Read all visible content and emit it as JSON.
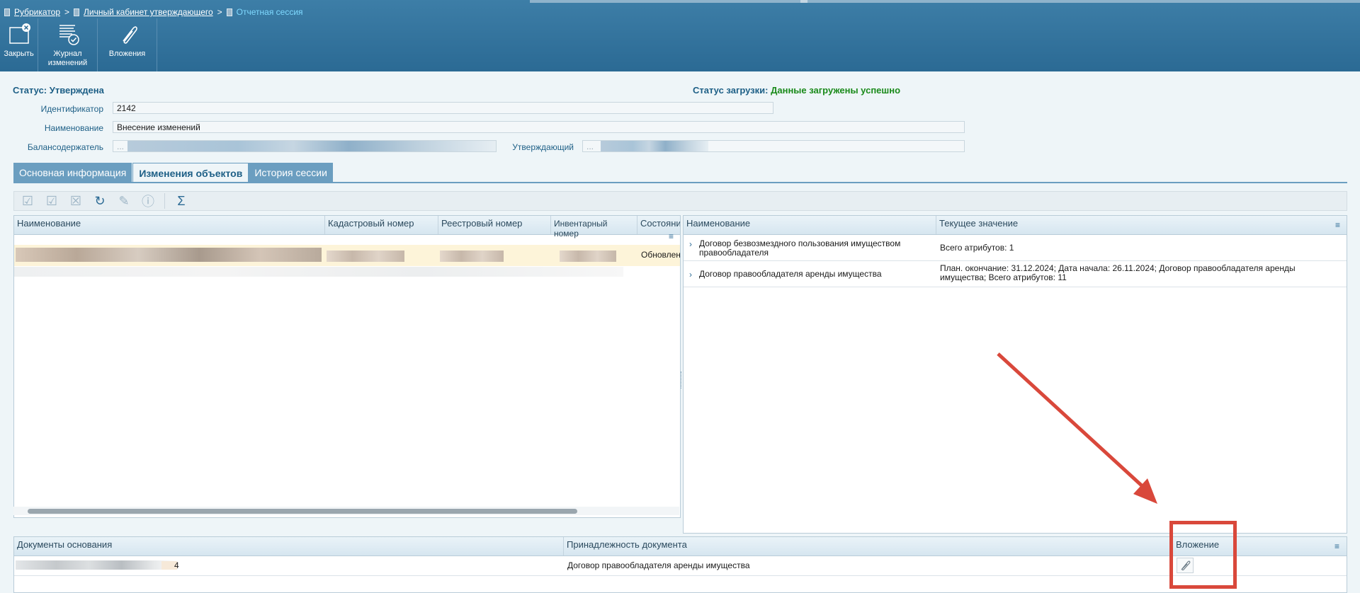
{
  "breadcrumb": {
    "items": [
      "Рубрикатор",
      "Личный кабинет утверждающего"
    ],
    "current": "Отчетная сессия",
    "separator": ">"
  },
  "toolbar": {
    "close_label": "Закрыть",
    "journal_label_1": "Журнал",
    "journal_label_2": "изменений",
    "attachments_label": "Вложения"
  },
  "status": {
    "status_text": "Статус: Утверждена",
    "upload_label": "Статус загрузки:",
    "upload_value": "Данные загружены успешно"
  },
  "fields": {
    "id_label": "Идентификатор",
    "id_value": "2142",
    "name_label": "Наименование",
    "name_value": "Внесение изменений",
    "holder_label": "Балансодержатель",
    "holder_prefix": "...",
    "approver_label": "Утверждающий",
    "approver_prefix": "..."
  },
  "tabs": [
    "Основная информация",
    "Изменения объектов",
    "История сессии"
  ],
  "objects_grid": {
    "columns": [
      "Наименование",
      "Кадастровый номер",
      "Реестровый номер",
      "Инвентарный номер",
      "Состояни"
    ],
    "rows": [
      {
        "state": "Обновлен"
      }
    ]
  },
  "changes_grid": {
    "columns": [
      "Наименование",
      "Текущее значение"
    ],
    "rows": [
      {
        "name": "Договор безвозмездного пользования имуществом правообладателя",
        "value": "Всего атрибутов: 1"
      },
      {
        "name": "Договор правообладателя аренды имущества",
        "value": "План. окончание: 31.12.2024; Дата начала: 26.11.2024; Договор правообладателя аренды имущества; Всего атрибутов: 11"
      }
    ]
  },
  "docs_grid": {
    "columns": [
      "Документы основания",
      "Принадлежность документа",
      "Вложение"
    ],
    "rows": [
      {
        "doc_suffix": "4",
        "belongs": "Договор правообладателя аренды имущества"
      }
    ]
  },
  "icons": {
    "menu": "≡",
    "chevron": "›",
    "sigma": "Σ"
  },
  "colors": {
    "header": "#2b6a94",
    "accent": "#1d5f86",
    "success": "#1a8a1a",
    "annotation": "#d9483b",
    "selected_row": "#fdf4d9"
  }
}
